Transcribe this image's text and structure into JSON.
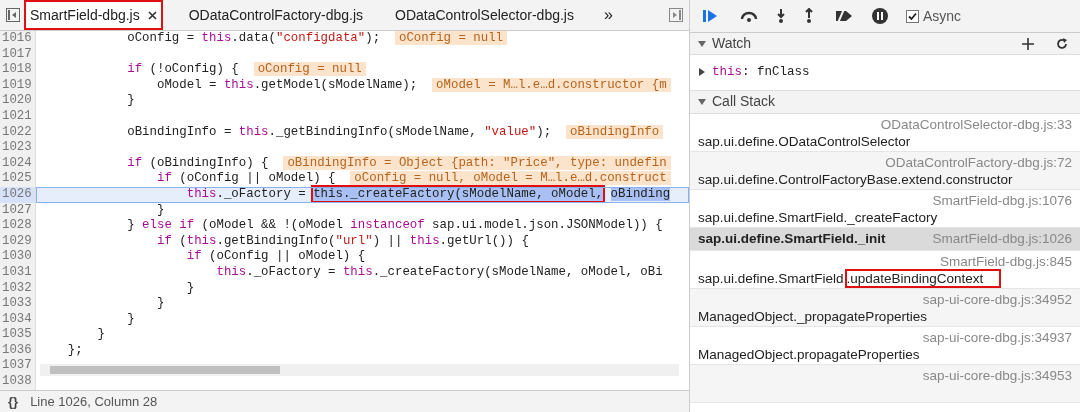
{
  "editor": {
    "tabs": [
      {
        "label": "SmartField-dbg.js",
        "selected": true,
        "closable": true,
        "boxed": true
      },
      {
        "label": "ODataControlFactory-dbg.js",
        "selected": false,
        "closable": false,
        "boxed": false
      },
      {
        "label": "ODataControlSelector-dbg.js",
        "selected": false,
        "closable": false,
        "boxed": false
      }
    ],
    "more": "»",
    "lines": [
      {
        "number": "1016",
        "current": false,
        "tokens": [
          {
            "kind": "plain",
            "text": "            oConfig = "
          },
          {
            "kind": "keyword",
            "text": "this"
          },
          {
            "kind": "plain",
            "text": ".data("
          },
          {
            "kind": "string",
            "text": "\"configdata\""
          },
          {
            "kind": "plain",
            "text": ");  "
          },
          {
            "kind": "value",
            "text": "oConfig = null"
          }
        ]
      },
      {
        "number": "1017",
        "current": false
      },
      {
        "number": "1018",
        "current": false,
        "tokens": [
          {
            "kind": "keyword",
            "text": "            if"
          },
          {
            "kind": "plain",
            "text": " (!oConfig) {  "
          },
          {
            "kind": "value",
            "text": "oConfig = null"
          }
        ]
      },
      {
        "number": "1019",
        "current": false,
        "tokens": [
          {
            "kind": "plain",
            "text": "                oModel = "
          },
          {
            "kind": "keyword",
            "text": "this"
          },
          {
            "kind": "plain",
            "text": ".getModel(sModelName);  "
          },
          {
            "kind": "value",
            "text": "oModel = M…l.e…d.constructor {m"
          }
        ]
      },
      {
        "number": "1020",
        "current": false,
        "tokens": [
          {
            "kind": "plain",
            "text": "            }"
          }
        ]
      },
      {
        "number": "1021",
        "current": false
      },
      {
        "number": "1022",
        "current": false,
        "tokens": [
          {
            "kind": "plain",
            "text": "            oBindingInfo = "
          },
          {
            "kind": "keyword",
            "text": "this"
          },
          {
            "kind": "plain",
            "text": "._getBindingInfo(sModelName, "
          },
          {
            "kind": "string",
            "text": "\"value\""
          },
          {
            "kind": "plain",
            "text": ");  "
          },
          {
            "kind": "value",
            "text": "oBindingInfo"
          }
        ]
      },
      {
        "number": "1023",
        "current": false
      },
      {
        "number": "1024",
        "current": false,
        "tokens": [
          {
            "kind": "keyword",
            "text": "            if"
          },
          {
            "kind": "plain",
            "text": " (oBindingInfo) {  "
          },
          {
            "kind": "value",
            "text": "oBindingInfo = Object {path: \"Price\", type: undefin"
          }
        ]
      },
      {
        "number": "1025",
        "current": false,
        "tokens": [
          {
            "kind": "keyword",
            "text": "                if"
          },
          {
            "kind": "plain",
            "text": " (oConfig || oModel) {  "
          },
          {
            "kind": "value",
            "text": "oConfig = null, oModel = M…l.e…d.construct"
          }
        ]
      },
      {
        "number": "1026",
        "current": true,
        "tokens": [
          {
            "kind": "keyword",
            "text": "                    this"
          },
          {
            "kind": "plain",
            "text": "._oFactory = "
          },
          {
            "kind": "boxed",
            "text": "this._createFactory(sModelName, oModel,"
          },
          {
            "kind": "selected",
            "text": " oBinding"
          }
        ]
      },
      {
        "number": "1027",
        "current": false,
        "tokens": [
          {
            "kind": "plain",
            "text": "                }"
          }
        ]
      },
      {
        "number": "1028",
        "current": false,
        "tokens": [
          {
            "kind": "plain",
            "text": "            } "
          },
          {
            "kind": "keyword",
            "text": "else if"
          },
          {
            "kind": "plain",
            "text": " (oModel && !(oModel "
          },
          {
            "kind": "keyword",
            "text": "instanceof"
          },
          {
            "kind": "plain",
            "text": " sap.ui.model.json.JSONModel)) {"
          }
        ]
      },
      {
        "number": "1029",
        "current": false,
        "tokens": [
          {
            "kind": "keyword",
            "text": "                if"
          },
          {
            "kind": "plain",
            "text": " ("
          },
          {
            "kind": "keyword",
            "text": "this"
          },
          {
            "kind": "plain",
            "text": ".getBindingInfo("
          },
          {
            "kind": "string",
            "text": "\"url\""
          },
          {
            "kind": "plain",
            "text": ") || "
          },
          {
            "kind": "keyword",
            "text": "this"
          },
          {
            "kind": "plain",
            "text": ".getUrl()) {"
          }
        ]
      },
      {
        "number": "1030",
        "current": false,
        "tokens": [
          {
            "kind": "keyword",
            "text": "                    if"
          },
          {
            "kind": "plain",
            "text": " (oConfig || oModel) {"
          }
        ]
      },
      {
        "number": "1031",
        "current": false,
        "tokens": [
          {
            "kind": "keyword",
            "text": "                        this"
          },
          {
            "kind": "plain",
            "text": "._oFactory = "
          },
          {
            "kind": "keyword",
            "text": "this"
          },
          {
            "kind": "plain",
            "text": "._createFactory(sModelName, oModel, oBi"
          }
        ]
      },
      {
        "number": "1032",
        "current": false,
        "tokens": [
          {
            "kind": "plain",
            "text": "                    }"
          }
        ]
      },
      {
        "number": "1033",
        "current": false,
        "tokens": [
          {
            "kind": "plain",
            "text": "                }"
          }
        ]
      },
      {
        "number": "1034",
        "current": false,
        "tokens": [
          {
            "kind": "plain",
            "text": "            }"
          }
        ]
      },
      {
        "number": "1035",
        "current": false,
        "tokens": [
          {
            "kind": "plain",
            "text": "        }"
          }
        ]
      },
      {
        "number": "1036",
        "current": false,
        "tokens": [
          {
            "kind": "plain",
            "text": "    };"
          }
        ]
      },
      {
        "number": "1037",
        "current": false
      },
      {
        "number": "1038",
        "current": false
      }
    ],
    "status": {
      "format_glyph": "{}",
      "position": "Line 1026, Column 28"
    }
  },
  "debugger": {
    "async": {
      "label": "Async",
      "checked": true
    },
    "watch": {
      "title": "Watch",
      "expanded": true,
      "items": [
        {
          "name": "this",
          "separator": ":",
          "value": "fnClass"
        }
      ]
    },
    "call_stack": {
      "title": "Call Stack",
      "expanded": true,
      "frames": [
        {
          "function": "sap.ui.define.ODataControlSelector",
          "location": "ODataControlSelector-dbg.js:33",
          "selected": false
        },
        {
          "function": "sap.ui.define.ControlFactoryBase.extend.constructor",
          "location": "ODataControlFactory-dbg.js:72",
          "selected": false
        },
        {
          "function": "sap.ui.define.SmartField._createFactory",
          "location": "SmartField-dbg.js:1076",
          "selected": false
        },
        {
          "function": "sap.ui.define.SmartField._init",
          "location": "SmartField-dbg.js:1026",
          "selected": true
        },
        {
          "function": "sap.ui.define.SmartField",
          "boxed_suffix": ".updateBindingContext",
          "location": "SmartField-dbg.js:845",
          "selected": false
        },
        {
          "function": "ManagedObject._propagateProperties",
          "location": "sap-ui-core-dbg.js:34952",
          "selected": false
        },
        {
          "function": "ManagedObject.propagateProperties",
          "location": "sap-ui-core-dbg.js:34937",
          "selected": false
        },
        {
          "location": "sap-ui-core-dbg.js:34953",
          "selected": false
        }
      ]
    }
  }
}
